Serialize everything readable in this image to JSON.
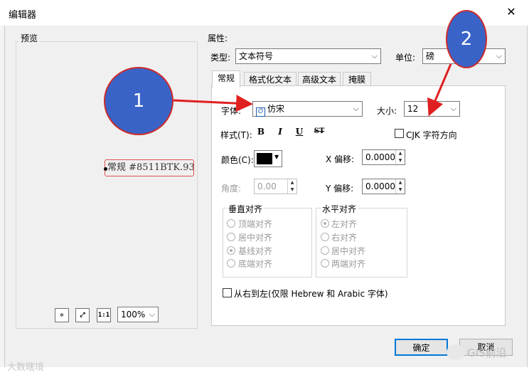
{
  "window": {
    "title": "编辑器",
    "close_glyph": "✕"
  },
  "preview": {
    "label": "预览",
    "sample_text": "常规 #8511BTK.93",
    "toolbar": {
      "fit_label": "1:1",
      "zoom": "100%"
    }
  },
  "properties": {
    "label": "属性:",
    "type_label": "类型:",
    "type_value": "文本符号",
    "unit_label": "单位:",
    "unit_value": "磅",
    "tabs": [
      {
        "label": "常规",
        "active": true
      },
      {
        "label": "格式化文本",
        "active": false
      },
      {
        "label": "高级文本",
        "active": false
      },
      {
        "label": "掩膜",
        "active": false
      }
    ],
    "font_label": "字体:",
    "font_value": "仿宋",
    "size_label": "大小:",
    "size_value": "12",
    "style_label": "样式(T):",
    "style_buttons": [
      "B",
      "I",
      "U",
      "ST"
    ],
    "cjk_label": "CJK 字符方向",
    "color_label": "颜色(C):",
    "color_swatch": "#000000",
    "x_offset_label": "X 偏移:",
    "x_offset_value": "0.0000",
    "angle_label": "角度:",
    "angle_value": "0.00",
    "y_offset_label": "Y 偏移:",
    "y_offset_value": "0.0000",
    "vertical_align": {
      "title": "垂直对齐",
      "options": [
        "顶端对齐",
        "居中对齐",
        "基线对齐",
        "底端对齐"
      ],
      "selected": "基线对齐"
    },
    "horizontal_align": {
      "title": "水平对齐",
      "options": [
        "左对齐",
        "右对齐",
        "居中对齐",
        "两端对齐"
      ],
      "selected": "左对齐"
    },
    "rtl_label": "从右到左(仅限 Hebrew 和 Arabic 字体)"
  },
  "footer": {
    "ok_label": "确定",
    "cancel_label": "取消"
  },
  "annotations": [
    {
      "label": "1",
      "color": "#3a63c7"
    },
    {
      "label": "2",
      "color": "#3a63c7"
    }
  ],
  "watermarks": {
    "left": "大数瞎境",
    "right": "GIS前沿"
  }
}
